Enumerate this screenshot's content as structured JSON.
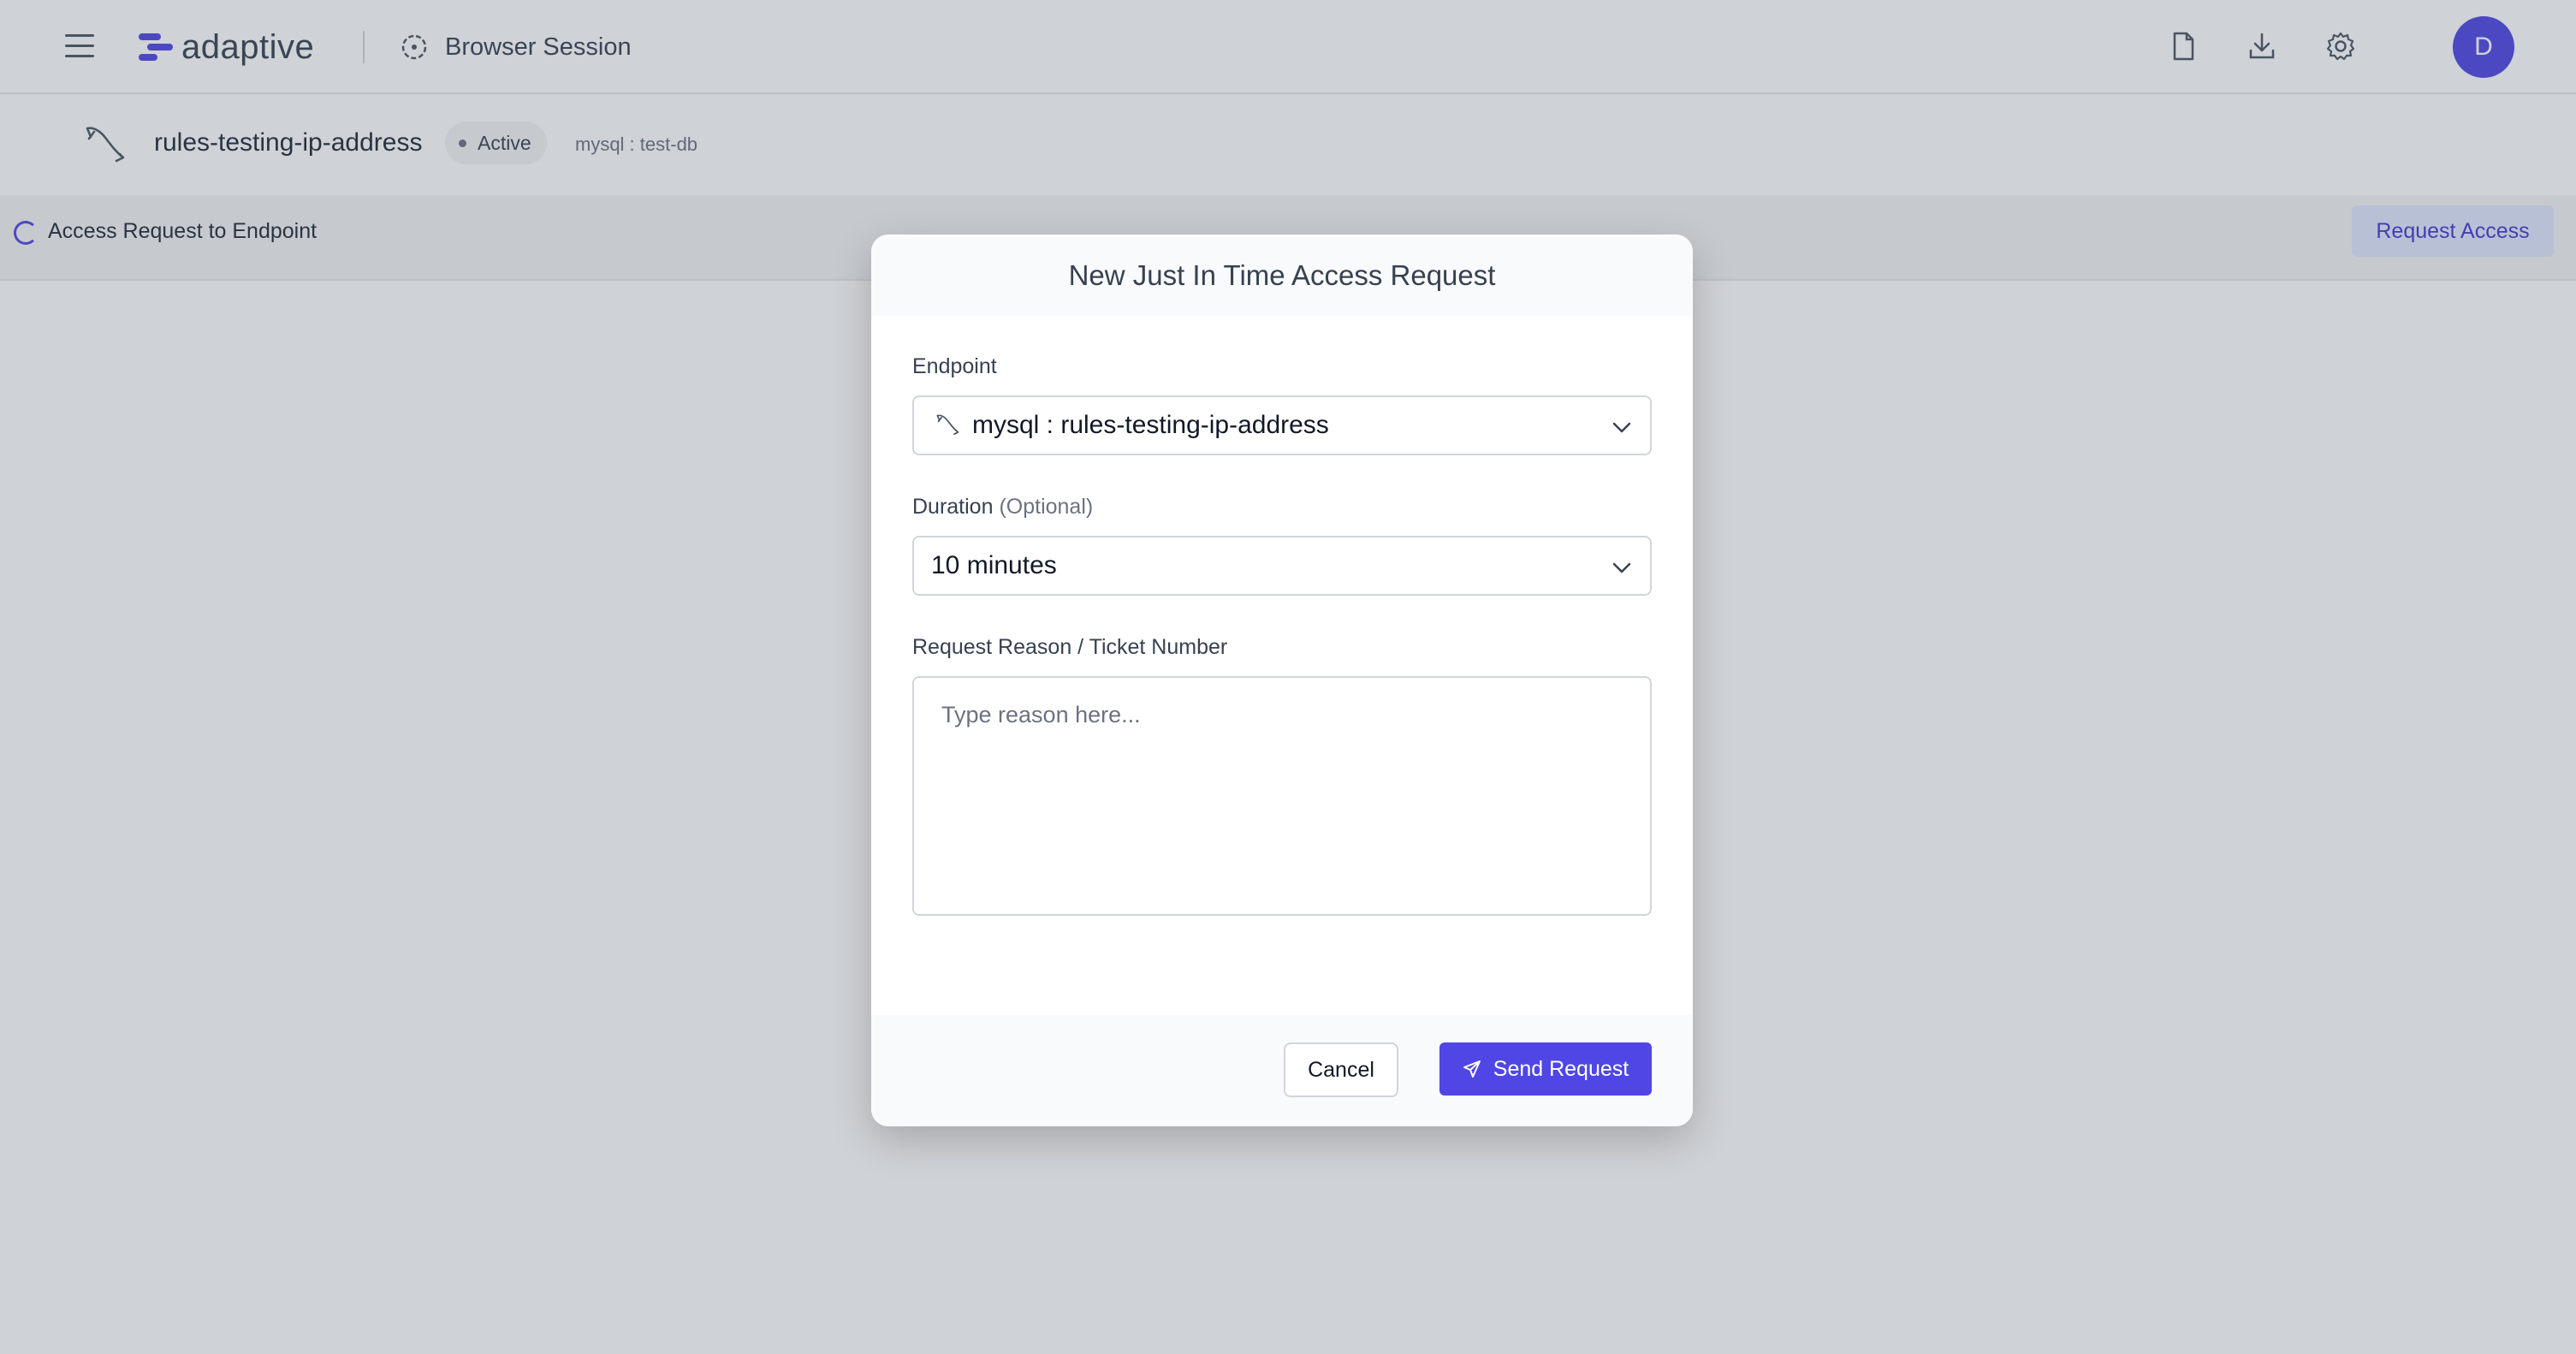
{
  "app": {
    "brand": "adaptive",
    "session_title": "Browser Session",
    "avatar_initial": "D",
    "icons": [
      "menu-icon",
      "clock-icon",
      "document-icon",
      "download-icon",
      "gear-icon"
    ]
  },
  "endpoint": {
    "name": "rules-testing-ip-address",
    "status": "Active",
    "meta": "mysql : test-db",
    "icon": "mysql-dolphin-icon"
  },
  "access_strip": {
    "title": "Access Request to Endpoint",
    "button_label": "Request Access"
  },
  "modal": {
    "title": "New Just In Time Access Request",
    "endpoint_label": "Endpoint",
    "endpoint_value": "mysql : rules-testing-ip-address",
    "duration_label": "Duration",
    "duration_optional": "(Optional)",
    "duration_value": "10 minutes",
    "reason_label": "Request Reason / Ticket Number",
    "reason_placeholder": "Type reason here...",
    "cancel_label": "Cancel",
    "send_label": "Send Request"
  },
  "colors": {
    "accent": "#4f46e5",
    "accent_light": "#e0e7ff"
  }
}
